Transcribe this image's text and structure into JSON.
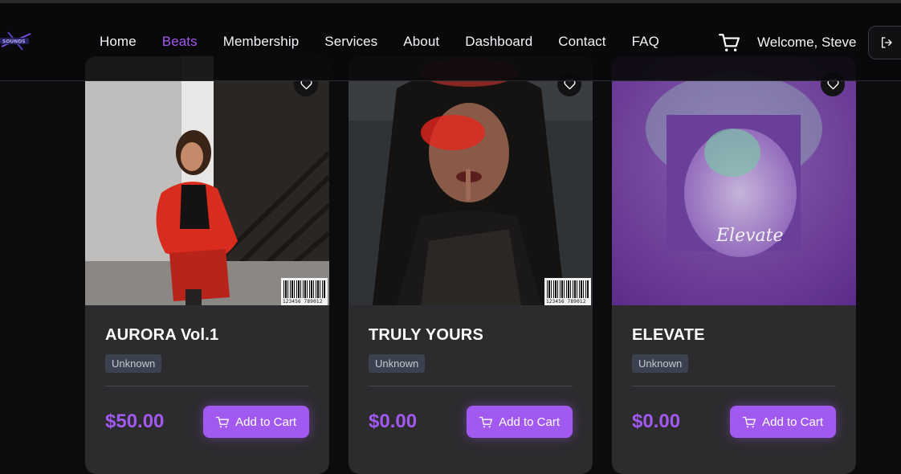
{
  "nav": {
    "links": [
      {
        "label": "Home",
        "active": false
      },
      {
        "label": "Beats",
        "active": true
      },
      {
        "label": "Membership",
        "active": false
      },
      {
        "label": "Services",
        "active": false
      },
      {
        "label": "About",
        "active": false
      },
      {
        "label": "Dashboard",
        "active": false
      },
      {
        "label": "Contact",
        "active": false
      },
      {
        "label": "FAQ",
        "active": false
      }
    ],
    "welcome": "Welcome, Steve",
    "logo_text": "SOUNDS"
  },
  "colors": {
    "accent": "#a259f0",
    "card": "#2c2b2e",
    "background": "#0c0b0d",
    "tag_bg": "#3c4150"
  },
  "products": [
    {
      "title": "AURORA Vol.1",
      "tag": "Unknown",
      "price": "$50.00",
      "button": "Add to Cart",
      "barcode": "123456 789012",
      "art": "woman-red-jacket-stairs"
    },
    {
      "title": "TRULY YOURS",
      "tag": "Unknown",
      "price": "$0.00",
      "button": "Add to Cart",
      "barcode": "123456 789012",
      "art": "woman-red-light-portrait"
    },
    {
      "title": "ELEVATE",
      "tag": "Unknown",
      "price": "$0.00",
      "button": "Add to Cart",
      "art_text": "Elevate",
      "art": "purple-cloud-head"
    }
  ]
}
